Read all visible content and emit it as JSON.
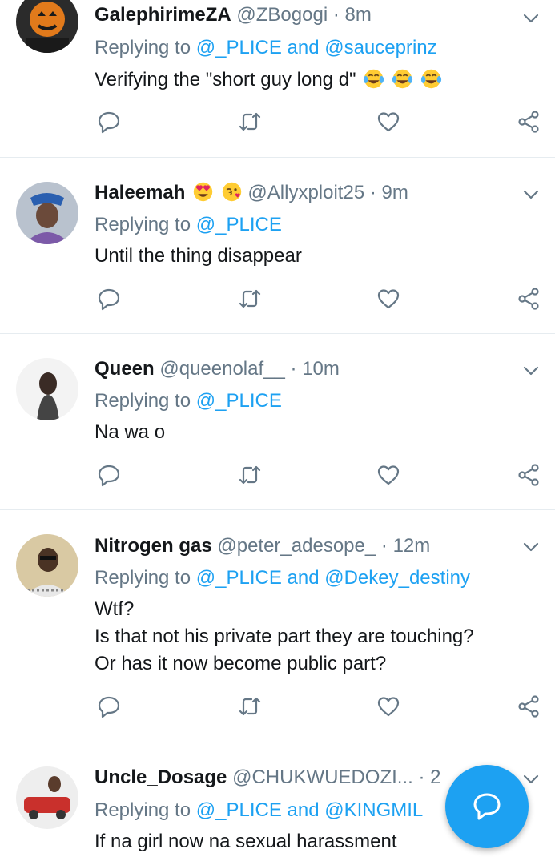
{
  "icons": {
    "reply": "reply-icon",
    "retweet": "retweet-icon",
    "like": "heart-icon",
    "share": "share-icon",
    "more": "chevron-down-icon",
    "compose": "compose-reply-icon"
  },
  "colors": {
    "accent": "#1da1f2",
    "secondary_text": "#657786",
    "primary_text": "#14171a",
    "divider": "#e6ecf0"
  },
  "tweets": [
    {
      "name": "GalephirimeZA",
      "handle": "@ZBogogi",
      "separator": "·",
      "time": "8m",
      "replying_prefix": "Replying to",
      "mentions": [
        "@_PLICE",
        "@sauceprinz"
      ],
      "joiner": "and",
      "text_lines": [
        "Verifying the \"short guy long d\""
      ],
      "emojis_after_text": [
        "face-with-tears-of-joy",
        "face-with-tears-of-joy",
        "face-with-tears-of-joy"
      ]
    },
    {
      "name": "Haleemah",
      "name_emojis": [
        "smiling-face-with-heart-eyes",
        "face-blowing-a-kiss"
      ],
      "handle": "@Allyxploit25",
      "separator": "·",
      "time": "9m",
      "replying_prefix": "Replying to",
      "mentions": [
        "@_PLICE"
      ],
      "text_lines": [
        "Until the thing disappear"
      ]
    },
    {
      "name": "Queen",
      "handle": "@queenolaf__",
      "separator": "·",
      "time": "10m",
      "replying_prefix": "Replying to",
      "mentions": [
        "@_PLICE"
      ],
      "text_lines": [
        "Na wa o"
      ]
    },
    {
      "name": "Nitrogen gas",
      "handle": "@peter_adesope_",
      "separator": "·",
      "time": "12m",
      "replying_prefix": "Replying to",
      "mentions": [
        "@_PLICE",
        "@Dekey_destiny"
      ],
      "joiner": "and",
      "text_lines": [
        "Wtf?",
        "Is that not his private part they are touching?",
        "Or has it now become public part?"
      ]
    },
    {
      "name": "Uncle_Dosage",
      "handle": "@CHUKWUEDOZI...",
      "separator": "·",
      "time": "2",
      "replying_prefix": "Replying to",
      "mentions": [
        "@_PLICE",
        "@KINGMIL"
      ],
      "joiner": "and",
      "text_lines": [
        "If na girl now na sexual harassment"
      ]
    }
  ]
}
